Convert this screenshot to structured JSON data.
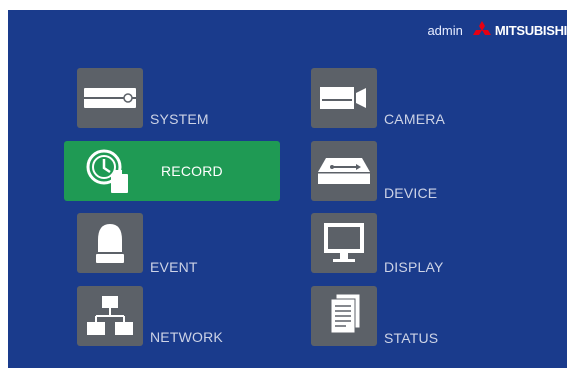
{
  "header": {
    "user": "admin",
    "brand": "MITSUBISHI"
  },
  "menu": [
    {
      "label": "SYSTEM",
      "icon": "system-icon"
    },
    {
      "label": "RECORD",
      "icon": "record-icon",
      "selected": true
    },
    {
      "label": "EVENT",
      "icon": "event-icon"
    },
    {
      "label": "NETWORK",
      "icon": "network-icon"
    },
    {
      "label": "CAMERA",
      "icon": "camera-icon"
    },
    {
      "label": "DEVICE",
      "icon": "device-icon"
    },
    {
      "label": "DISPLAY",
      "icon": "display-icon"
    },
    {
      "label": "STATUS",
      "icon": "status-icon"
    }
  ],
  "colors": {
    "background": "#1a3b8c",
    "tile": "#5c6168",
    "selected": "#1f9a54",
    "logo": "#e60012"
  }
}
